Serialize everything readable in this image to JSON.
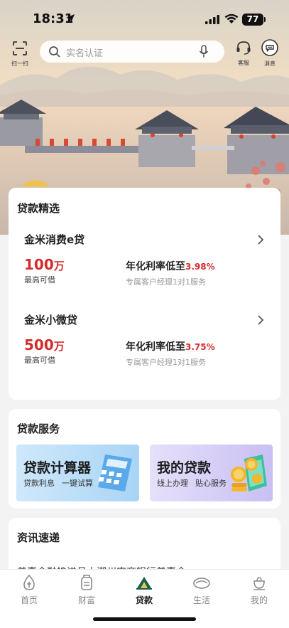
{
  "status_bar": {
    "time": "18:31",
    "battery": "77"
  },
  "top_bar": {
    "scan_label": "扫一扫",
    "search_placeholder": "实名认证",
    "service_label": "客服",
    "message_label": "消息"
  },
  "colors": {
    "accent_red": "#d42b2b",
    "tab_active": "#1a5e4d"
  },
  "loan_section": {
    "title": "贷款精选",
    "products": [
      {
        "name": "金米消费e贷",
        "amount": "100",
        "unit": "万",
        "amount_label": "最高可借",
        "rate_prefix": "年化利率低至",
        "rate_value": "3.98%",
        "note": "专属客户经理1对1服务"
      },
      {
        "name": "金米小微贷",
        "amount": "500",
        "unit": "万",
        "amount_label": "最高可借",
        "rate_prefix": "年化利率低至",
        "rate_value": "3.75%",
        "note": "专属客户经理1对1服务"
      }
    ]
  },
  "service_section": {
    "title": "贷款服务",
    "tiles": [
      {
        "title": "贷款计算器",
        "sub1": "贷款利息",
        "sub2": "一键试算",
        "icon": "calculator-icon"
      },
      {
        "title": "我的贷款",
        "sub1": "线上办理",
        "sub2": "贴心服务",
        "icon": "coins-phone-icon"
      }
    ]
  },
  "news_section": {
    "title": "资讯速递",
    "clip": "普惠金融推进月丨潮州农商银行普惠金"
  },
  "tabs": [
    {
      "label": "首页",
      "icon": "home-icon"
    },
    {
      "label": "财富",
      "icon": "wealth-icon"
    },
    {
      "label": "贷款",
      "icon": "loan-icon"
    },
    {
      "label": "生活",
      "icon": "life-icon"
    },
    {
      "label": "我的",
      "icon": "mine-icon"
    }
  ]
}
